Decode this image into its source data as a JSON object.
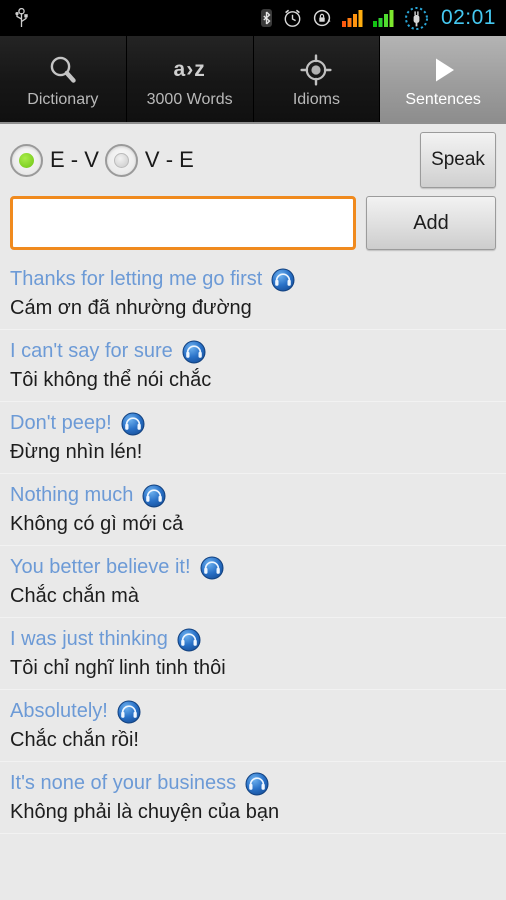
{
  "status_bar": {
    "left_icons": [
      {
        "name": "usb-icon",
        "label": "USB"
      }
    ],
    "right_icons": [
      {
        "name": "bluetooth-icon",
        "label": "Bluetooth"
      },
      {
        "name": "alarm-clock-icon",
        "label": "Alarm"
      },
      {
        "name": "rotation-lock-icon",
        "label": "Rotation lock"
      },
      {
        "name": "signal-bars-orange-icon",
        "label": "Signal 1"
      },
      {
        "name": "signal-bars-green-icon",
        "label": "Signal 2"
      },
      {
        "name": "battery-charging-icon",
        "label": "Charging"
      }
    ],
    "clock": "02:01",
    "clock_color": "#45c8f0"
  },
  "tabs": [
    {
      "label": "Dictionary",
      "icon": "magnifier-icon",
      "active": false
    },
    {
      "label": "3000 Words",
      "icon": "a-to-z-icon",
      "icon_text": "a›z",
      "active": false
    },
    {
      "label": "Idioms",
      "icon": "crosshair-target-icon",
      "active": false
    },
    {
      "label": "Sentences",
      "icon": "play-triangle-icon",
      "active": true
    }
  ],
  "controls": {
    "direction_options": [
      {
        "label": "E - V",
        "selected": true
      },
      {
        "label": "V - E",
        "selected": false
      }
    ],
    "speak_label": "Speak",
    "add_label": "Add",
    "input_value": "",
    "input_placeholder": ""
  },
  "colors": {
    "accent_orange": "#f08a1e",
    "english_blue": "#6c9ad6",
    "selected_radio_green": "#6cc413",
    "list_background": "#e9e9e9"
  },
  "sentences": [
    {
      "en": "Thanks for letting me go first",
      "vi": "Cám ơn đã nhường đường",
      "icon": "speaker-headphone-icon"
    },
    {
      "en": "I can't say for sure",
      "vi": "Tôi không thể nói chắc",
      "icon": "speaker-headphone-icon"
    },
    {
      "en": "Don't peep!",
      "vi": "Đừng nhìn lén!",
      "icon": "speaker-headphone-icon"
    },
    {
      "en": "Nothing much",
      "vi": "Không có gì mới cả",
      "icon": "speaker-headphone-icon"
    },
    {
      "en": "You better believe it!",
      "vi": "Chắc chắn mà",
      "icon": "speaker-headphone-icon"
    },
    {
      "en": "I was just thinking",
      "vi": "Tôi chỉ nghĩ linh tinh thôi",
      "icon": "speaker-headphone-icon"
    },
    {
      "en": "Absolutely!",
      "vi": "Chắc chắn rồi!",
      "icon": "speaker-headphone-icon"
    },
    {
      "en": "It's none of your business",
      "vi": "Không phải là chuyện của bạn",
      "icon": "speaker-headphone-icon"
    }
  ]
}
